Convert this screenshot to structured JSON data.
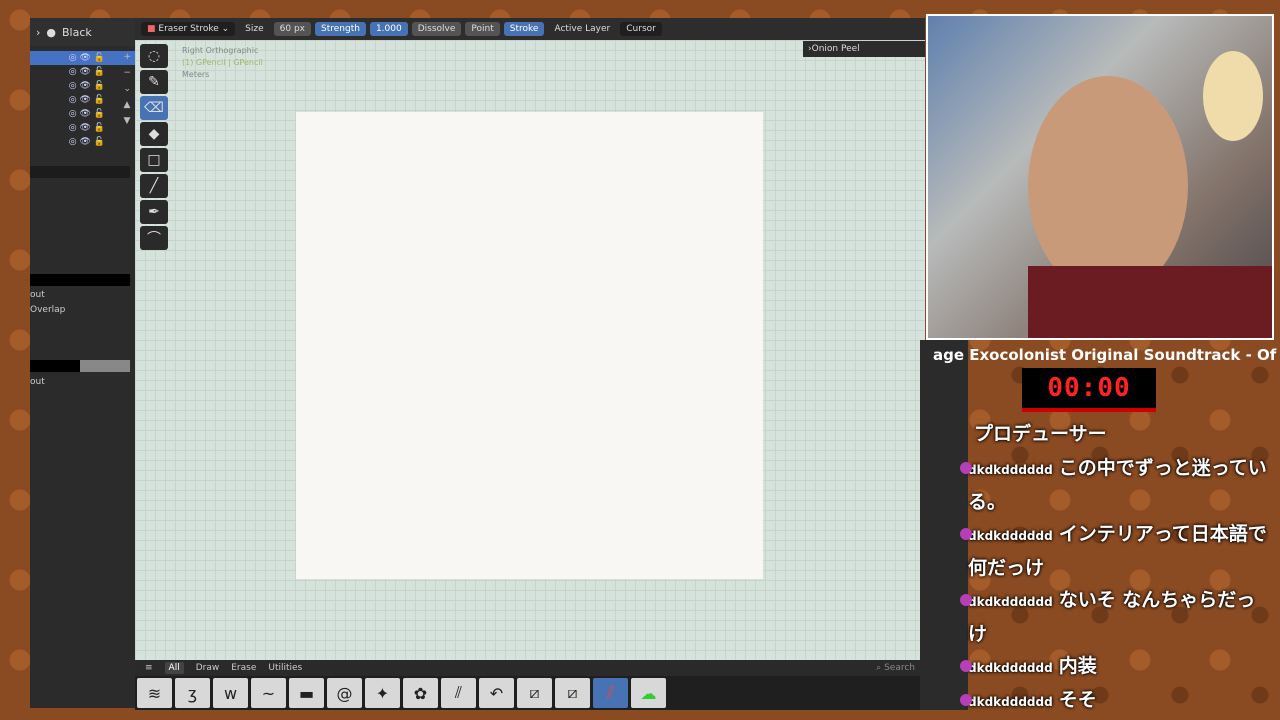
{
  "left_panel": {
    "header_label": "Black",
    "prop_out": "out",
    "prop_overlap": "Overlap",
    "prop_out2": "out"
  },
  "topbar": {
    "tool": "Eraser Stroke",
    "size_label": "Size",
    "size_value": "60 px",
    "strength_label": "Strength",
    "strength_value": "1.000",
    "mode_dissolve": "Dissolve",
    "mode_point": "Point",
    "mode_stroke": "Stroke",
    "active_layer": "Active Layer",
    "cursor": "Cursor"
  },
  "viewport": {
    "view_name": "Right Orthographic",
    "object_name": "(1) GPencil | GPencil",
    "units": "Meters",
    "onion_peel": "Onion Peel"
  },
  "asset_bar": {
    "tabs": [
      "All",
      "Draw",
      "Erase",
      "Utilities"
    ],
    "search_placeholder": "Search"
  },
  "overlay": {
    "song": "age Exocolonist Original Soundtrack - Of",
    "timer": "00:00",
    "chat": [
      {
        "user": "",
        "text": "プロデューサー"
      },
      {
        "user": "dkdkdddddd",
        "text": "この中でずっと迷っている。"
      },
      {
        "user": "dkdkdddddd",
        "text": "インテリアって日本語で何だっけ"
      },
      {
        "user": "dkdkdddddd",
        "text": "ないそ なんちゃらだっけ"
      },
      {
        "user": "dkdkdddddd",
        "text": "内装"
      },
      {
        "user": "dkdkdddddd",
        "text": "そそ"
      }
    ]
  }
}
